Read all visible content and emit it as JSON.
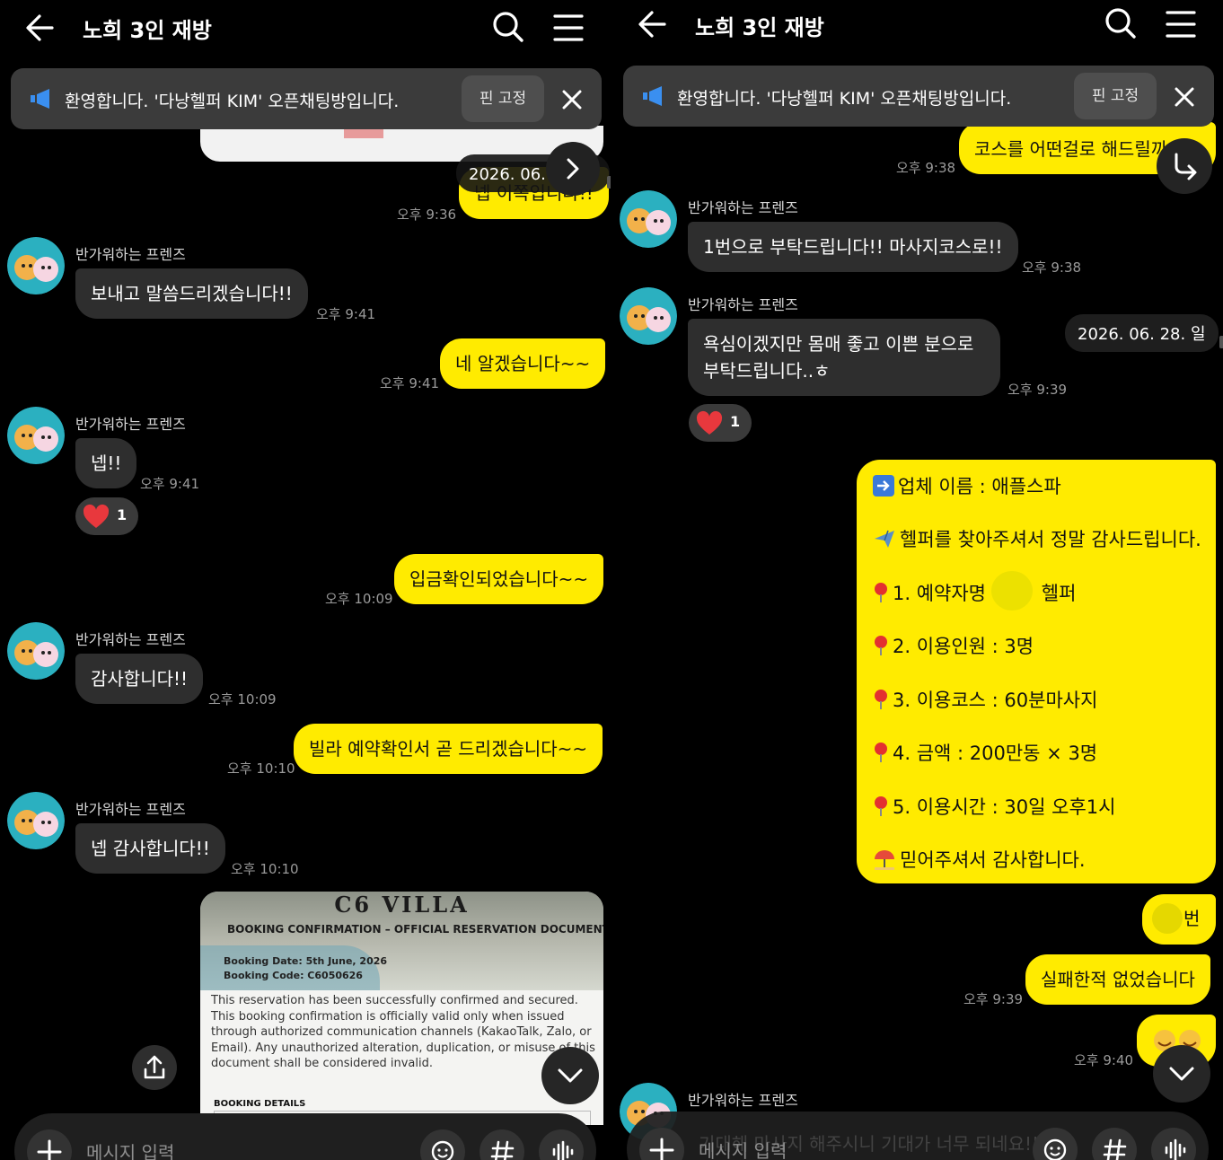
{
  "room": {
    "title": "노희 3인 재방"
  },
  "notice": {
    "text": "환영합니다. '다낭헬퍼 KIM' 오픈채팅방입니다.",
    "pin_label": "핀 고정"
  },
  "input": {
    "placeholder": "메시지 입력"
  },
  "left": {
    "date_pill": "2026. 06. 05. 금",
    "partial_msg": "넵 이쪽입니다!!",
    "partial_time": "오후 9:36",
    "messages": [
      {
        "sender": "반가워하는 프렌즈",
        "text": "보내고 말씀드리겠습니다!!",
        "time": "오후 9:41"
      },
      {
        "text": "네 알겠습니다~~",
        "time": "오후 9:41"
      },
      {
        "sender": "반가워하는 프렌즈",
        "text": "넵!!",
        "time": "오후 9:41",
        "reaction_count": "1"
      },
      {
        "text": "입금확인되었습니다~~",
        "time": "오후 10:09"
      },
      {
        "sender": "반가워하는 프렌즈",
        "text": "감사합니다!!",
        "time": "오후 10:09"
      },
      {
        "text": "빌라 예약확인서 곧 드리겠습니다~~",
        "time": "오후 10:10"
      },
      {
        "sender": "반가워하는 프렌즈",
        "text": "넵 감사합니다!!",
        "time": "오후 10:10"
      }
    ],
    "villa": {
      "title": "C6 VILLA",
      "subtitle": "BOOKING CONFIRMATION – OFFICIAL RESERVATION DOCUMENT",
      "booking_date": "Booking Date: 5th June, 2026",
      "booking_code": "Booking Code: C6050626",
      "body": "This reservation has been successfully confirmed and secured. This booking confirmation is officially valid only when issued through authorized communication channels (KakaoTalk, Zalo, or Email). Any unauthorized alteration, duplication, or misuse of this document shall be considered invalid.",
      "details_heading": "BOOKING DETAILS"
    }
  },
  "right": {
    "date_pill": "2026. 06. 28. 일",
    "top_msg": "코스를 어떤걸로 해드릴까",
    "top_time": "오후 9:38",
    "messages": [
      {
        "sender": "반가워하는 프렌즈",
        "text": "1번으로 부탁드립니다!! 마사지코스로!!",
        "time": "오후 9:38"
      },
      {
        "sender": "반가워하는 프렌즈",
        "text_line1": "욕심이겠지만 몸매 좋고 이쁜 분으로",
        "text_line2": "부탁드립니다..ㅎ",
        "time": "오후 9:39",
        "reaction_count": "1"
      }
    ],
    "info_card": {
      "line0": "업체 이름 : 애플스파",
      "line1": "헬퍼를 찾아주셔서 정말 감사드립니다.",
      "line2a": "1. 예약자명 :",
      "line2b": "헬퍼",
      "line3": "2. 이용인원 :  3명",
      "line4": "3. 이용코스 : 60분마사지",
      "line5": "4. 금액 : 200만동 × 3명",
      "line6": "5. 이용시간 : 30일 오후1시",
      "line7": "믿어주셔서 감사합니다."
    },
    "small_msg": "번",
    "msg_fail": "실패한적 없었습니다",
    "msg_fail_time": "오후 9:39",
    "emoji_time": "오후 9:40",
    "last_sender": "반가워하는 프렌즈",
    "last_partial": "기대해 마사지 해주시니 기대가 너무 되네요!!"
  },
  "colors": {
    "yellow": "#ffeb00",
    "bubble_in": "#2e2e2e",
    "background": "#000000"
  }
}
